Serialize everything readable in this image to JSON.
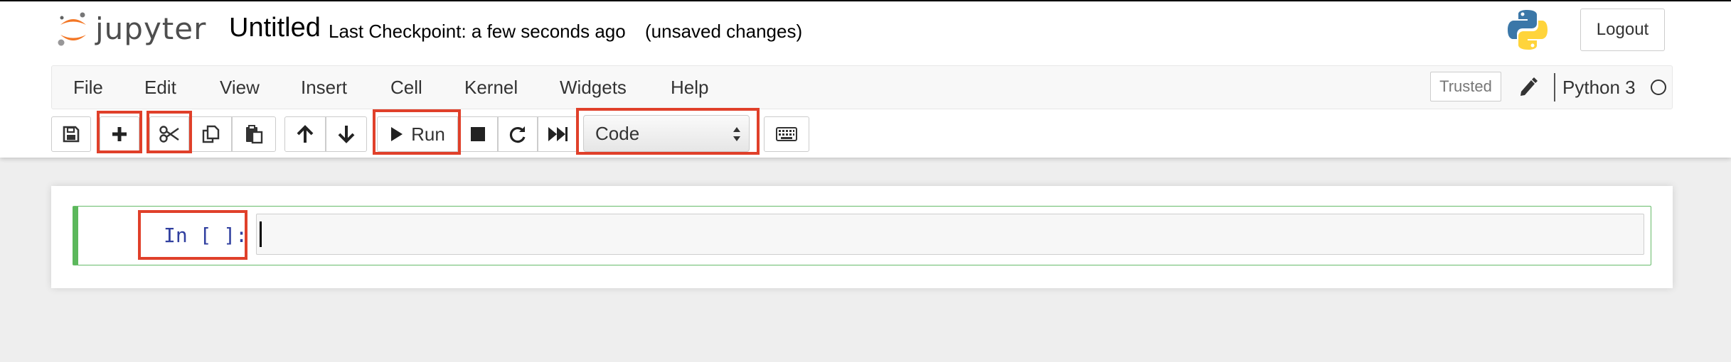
{
  "header": {
    "logo_text": "jupyter",
    "notebook_name": "Untitled",
    "checkpoint": "Last Checkpoint: a few seconds ago",
    "autosave_status": "(unsaved changes)",
    "logout_label": "Logout"
  },
  "menubar": {
    "items": [
      "File",
      "Edit",
      "View",
      "Insert",
      "Cell",
      "Kernel",
      "Widgets",
      "Help"
    ],
    "trusted_label": "Trusted",
    "kernel_name": "Python 3"
  },
  "toolbar": {
    "run_label": "Run",
    "cell_type": "Code",
    "icons": [
      "save-icon",
      "plus-icon",
      "scissors-icon",
      "copy-icon",
      "paste-icon",
      "arrow-up-icon",
      "arrow-down-icon",
      "play-icon",
      "stop-icon",
      "restart-icon",
      "fast-forward-icon",
      "keyboard-icon"
    ]
  },
  "cell": {
    "prompt": "In [ ]:",
    "source": ""
  },
  "colors": {
    "highlight": "#e0402a",
    "cell_border": "#5cb85c",
    "prompt": "#303f9f",
    "jupyter_orange": "#f37726"
  }
}
